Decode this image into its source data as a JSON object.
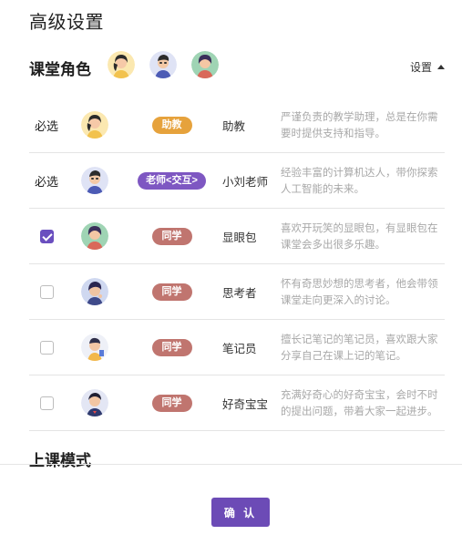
{
  "title": "高级设置",
  "role_section": {
    "title": "课堂角色",
    "settings_label": "设置",
    "header_avatars": [
      "teaching-assistant-avatar",
      "teacher-avatar",
      "classmate-avatar"
    ]
  },
  "roles": [
    {
      "select": "必选",
      "checked": null,
      "avatar": "teaching-assistant-avatar",
      "badge": "助教",
      "badge_color": "#e6a23c",
      "name": "助教",
      "desc": "严谨负责的教学助理，总是在你需要时提供支持和指导。"
    },
    {
      "select": "必选",
      "checked": null,
      "avatar": "teacher-avatar",
      "badge": "老师<交互>",
      "badge_color": "#7e57c2",
      "name": "小刘老师",
      "desc": "经验丰富的计算机达人，带你探索人工智能的未来。"
    },
    {
      "select": "",
      "checked": true,
      "avatar": "class-clown-avatar",
      "badge": "同学",
      "badge_color": "#c0756f",
      "name": "显眼包",
      "desc": "喜欢开玩笑的显眼包，有显眼包在课堂会多出很多乐趣。"
    },
    {
      "select": "",
      "checked": false,
      "avatar": "thinker-avatar",
      "badge": "同学",
      "badge_color": "#c0756f",
      "name": "思考者",
      "desc": "怀有奇思妙想的思考者，他会带领课堂走向更深入的讨论。"
    },
    {
      "select": "",
      "checked": false,
      "avatar": "note-taker-avatar",
      "badge": "同学",
      "badge_color": "#c0756f",
      "name": "笔记员",
      "desc": "擅长记笔记的笔记员，喜欢跟大家分享自己在课上记的笔记。"
    },
    {
      "select": "",
      "checked": false,
      "avatar": "curious-student-avatar",
      "badge": "同学",
      "badge_color": "#c0756f",
      "name": "好奇宝宝",
      "desc": "充满好奇心的好奇宝宝，会时不时的提出问题，带着大家一起进步。"
    }
  ],
  "mode_section": {
    "title": "上课模式"
  },
  "confirm_label": "确 认",
  "colors": {
    "accent": "#6c4bb6",
    "assistant_badge": "#e6a23c",
    "teacher_badge": "#7e57c2",
    "student_badge": "#c0756f"
  }
}
